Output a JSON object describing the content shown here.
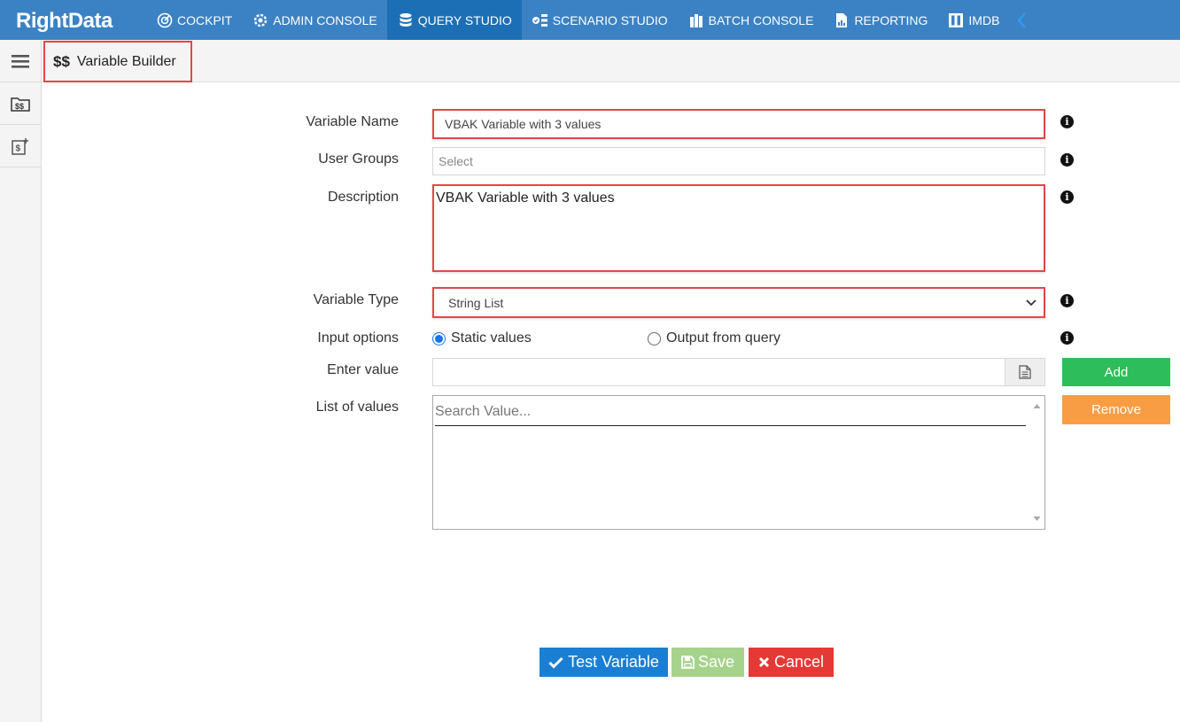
{
  "app": {
    "logo_text": "RightData"
  },
  "nav": {
    "items": [
      {
        "label": "COCKPIT",
        "icon": "cockpit-icon"
      },
      {
        "label": "ADMIN CONSOLE",
        "icon": "gear-icon"
      },
      {
        "label": "QUERY STUDIO",
        "icon": "database-icon",
        "active": true
      },
      {
        "label": "SCENARIO STUDIO",
        "icon": "scenario-icon"
      },
      {
        "label": "BATCH CONSOLE",
        "icon": "batch-icon"
      },
      {
        "label": "REPORTING",
        "icon": "report-icon"
      },
      {
        "label": "IMDB",
        "icon": "imdb-icon"
      }
    ],
    "collapse_icon": "chevron-left-icon"
  },
  "page": {
    "title_icon": "$$",
    "title": "Variable Builder"
  },
  "form": {
    "variable_name_label": "Variable Name",
    "variable_name_value": "VBAK Variable with 3 values",
    "user_groups_label": "User Groups",
    "user_groups_placeholder": "Select",
    "description_label": "Description",
    "description_value": "VBAK Variable with 3 values",
    "variable_type_label": "Variable Type",
    "variable_type_value": "String List",
    "input_options_label": "Input options",
    "option_static": "Static values",
    "option_query": "Output from query",
    "selected_option": "Static values",
    "enter_value_label": "Enter value",
    "enter_value_value": "",
    "list_label": "List of values",
    "search_placeholder": "Search Value..."
  },
  "buttons": {
    "add": "Add",
    "remove": "Remove",
    "test": "Test Variable",
    "save": "Save",
    "cancel": "Cancel"
  },
  "colors": {
    "nav_bg": "#3b82c4",
    "nav_active": "#1d6fb5",
    "highlight_border": "#e04848",
    "add_green": "#2dbd5a",
    "remove_orange": "#f99d45",
    "test_blue": "#1a7fd4",
    "save_green_disabled": "#a6d38c",
    "cancel_red": "#e53935"
  }
}
